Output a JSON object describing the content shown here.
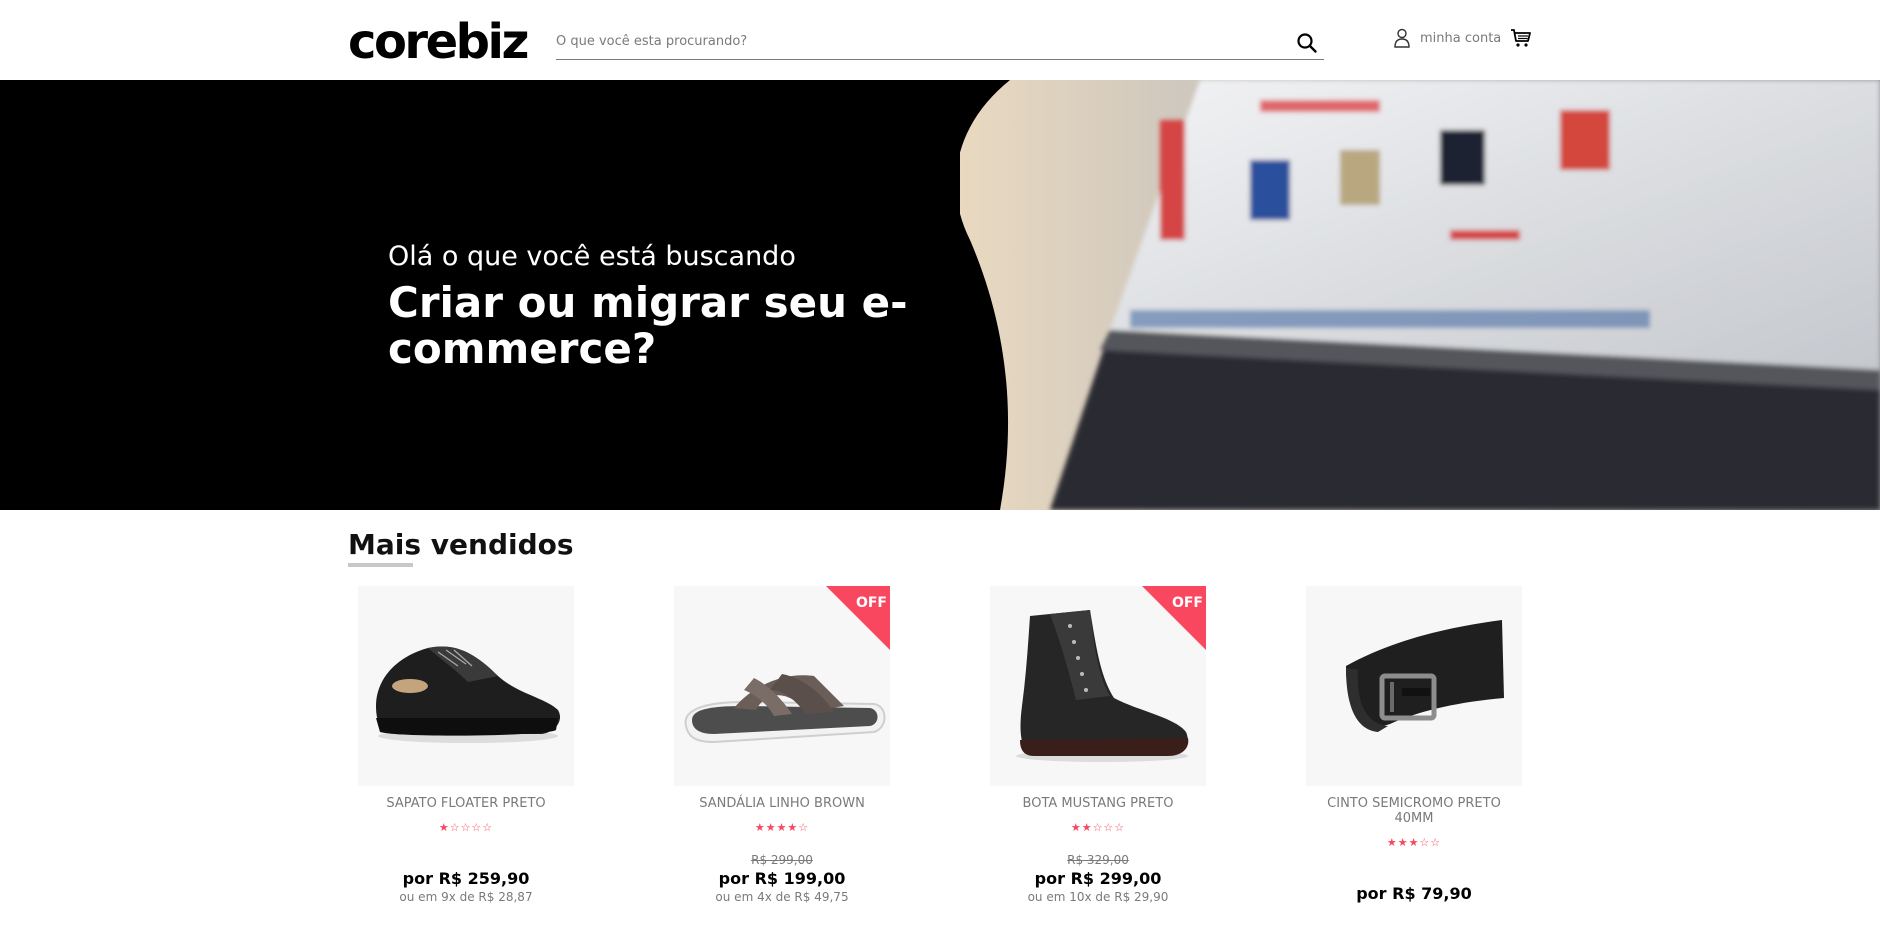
{
  "header": {
    "logo": "corebiz",
    "search_placeholder": "O que você esta procurando?",
    "account_label": "minha conta"
  },
  "banner": {
    "subtitle": "Olá o que você está buscando",
    "title": "Criar ou migrar seu e-commerce?"
  },
  "section": {
    "title": "Mais vendidos"
  },
  "products": [
    {
      "name": "SAPATO FLOATER PRETO",
      "stars": "★☆☆☆☆",
      "list_price": "",
      "price": "por R$ 259,90",
      "installments": "ou em 9x de R$ 28,87",
      "off": ""
    },
    {
      "name": "SANDÁLIA LINHO BROWN",
      "stars": "★★★★☆",
      "list_price": "R$ 299,00",
      "price": "por R$ 199,00",
      "installments": "ou em 4x de R$ 49,75",
      "off": "OFF"
    },
    {
      "name": "BOTA MUSTANG PRETO",
      "stars": "★★☆☆☆",
      "list_price": "R$ 329,00",
      "price": "por R$ 299,00",
      "installments": "ou em 10x de R$ 29,90",
      "off": "OFF"
    },
    {
      "name": "CINTO SEMICROMO PRETO 40MM",
      "stars": "★★★☆☆",
      "list_price": "",
      "price": "por R$ 79,90",
      "installments": "",
      "off": ""
    }
  ],
  "colors": {
    "accent": "#f8475f",
    "banner_bg": "#000000"
  }
}
